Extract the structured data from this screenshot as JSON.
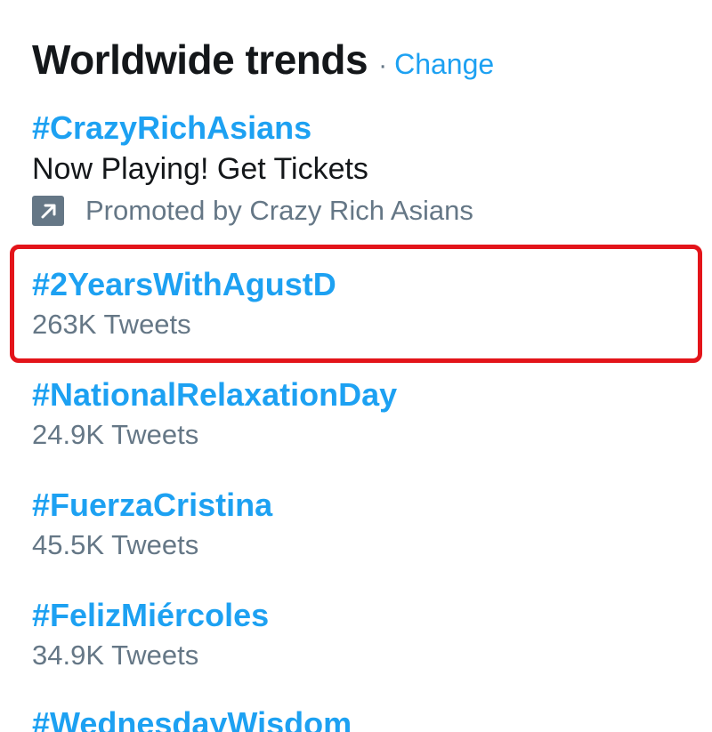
{
  "header": {
    "title": "Worldwide trends",
    "separator": "·",
    "change_label": "Change"
  },
  "promoted": {
    "hashtag": "#CrazyRichAsians",
    "description": "Now Playing! Get Tickets",
    "promoted_text": "Promoted by Crazy Rich Asians",
    "icon": "promoted-arrow-icon"
  },
  "trends": [
    {
      "hashtag": "#2YearsWithAgustD",
      "count": "263K Tweets"
    },
    {
      "hashtag": "#NationalRelaxationDay",
      "count": "24.9K Tweets"
    },
    {
      "hashtag": "#FuerzaCristina",
      "count": "45.5K Tweets"
    },
    {
      "hashtag": "#FelizMiércoles",
      "count": "34.9K Tweets"
    },
    {
      "hashtag": "#WednesdayWisdom"
    }
  ],
  "colors": {
    "accent": "#1da1f2",
    "text_primary": "#14171a",
    "text_secondary": "#657786",
    "highlight_border": "#e3141a"
  }
}
